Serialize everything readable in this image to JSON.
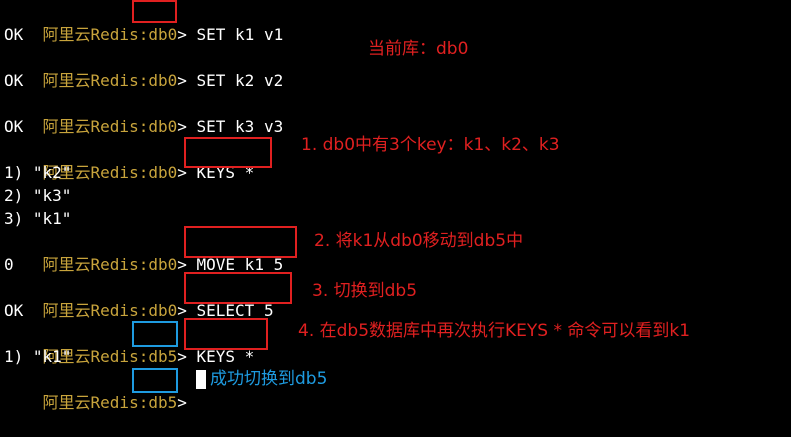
{
  "terminal": {
    "prompt_prefix": "阿里云Redis:",
    "lines": [
      {
        "db": "db0",
        "sep": "> ",
        "cmd": "SET k1 v1"
      },
      {
        "out": "OK"
      },
      {
        "db": "db0",
        "sep": "> ",
        "cmd": "SET k2 v2"
      },
      {
        "out": "OK"
      },
      {
        "db": "db0",
        "sep": "> ",
        "cmd": "SET k3 v3"
      },
      {
        "out": "OK"
      },
      {
        "db": "db0",
        "sep": "> ",
        "cmd": "KEYS *"
      },
      {
        "out": "1) \"k2\""
      },
      {
        "out": "2) \"k3\""
      },
      {
        "out": "3) \"k1\""
      },
      {
        "db": "db0",
        "sep": "> ",
        "cmd": "MOVE k1 5"
      },
      {
        "out": "0"
      },
      {
        "db": "db0",
        "sep": "> ",
        "cmd": "SELECT 5"
      },
      {
        "out": "OK"
      },
      {
        "db": "db5",
        "sep": "> ",
        "cmd": "KEYS *"
      },
      {
        "out": "1) \"k1\""
      },
      {
        "db": "db5",
        "sep": "> ",
        "cmd": ""
      }
    ]
  },
  "annotations": {
    "current_db": "当前库：db0",
    "note1": "1. db0中有3个key：k1、k2、k3",
    "note2": "2. 将k1从db0移动到db5中",
    "note3": "3. 切换到db5",
    "note4": "4. 在db5数据库中再次执行KEYS * 命令可以看到k1",
    "note5": "成功切换到db5"
  },
  "colors": {
    "background": "#000000",
    "prompt": "#c8a43c",
    "annotation_red": "#e02020",
    "annotation_blue": "#1e9be0"
  }
}
